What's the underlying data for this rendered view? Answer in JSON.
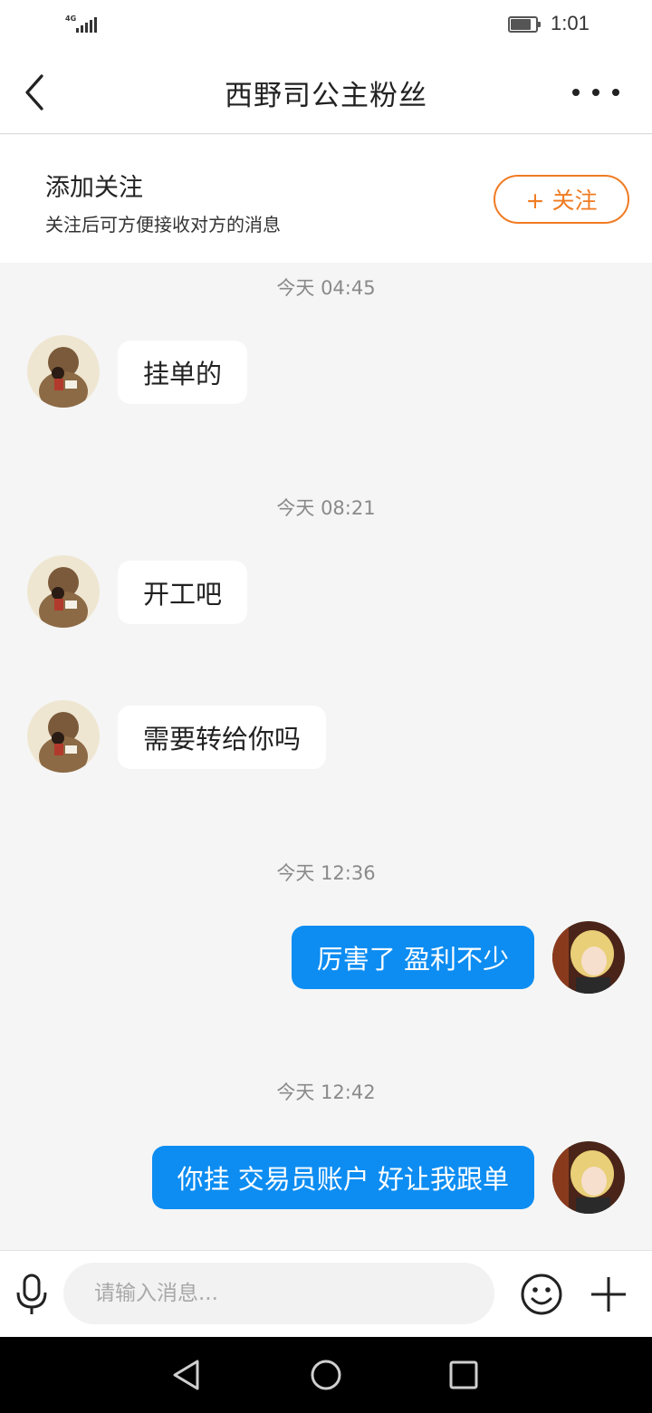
{
  "status_bar": {
    "network": "4G",
    "time": "1:01",
    "battery_level": 0.7
  },
  "header": {
    "title": "西野司公主粉丝",
    "back_icon": "chevron-left-icon",
    "more_icon": "more-horizontal-icon"
  },
  "follow_banner": {
    "title": "添加关注",
    "subtitle": "关注后可方便接收对方的消息",
    "button_label": "+ 关注",
    "accent_color": "#f07b22"
  },
  "chat": {
    "timestamps": [
      "今天 04:45",
      "今天 08:21",
      "今天 12:36",
      "今天 12:42"
    ],
    "messages": [
      {
        "text": "挂单的",
        "direction": "incoming"
      },
      {
        "text": "开工吧",
        "direction": "incoming"
      },
      {
        "text": "需要转给你吗",
        "direction": "incoming"
      },
      {
        "text": "厉害了 盈利不少",
        "direction": "outgoing"
      },
      {
        "text": "你挂 交易员账户 好让我跟单",
        "direction": "outgoing"
      }
    ],
    "outgoing_bubble_color": "#0d8df2",
    "incoming_bubble_color": "#ffffff"
  },
  "input_bar": {
    "placeholder": "请输入消息...",
    "mic_icon": "microphone-icon",
    "emoji_icon": "smiley-icon",
    "plus_icon": "plus-icon"
  },
  "nav_bar": {
    "back_icon": "triangle-back-icon",
    "home_icon": "circle-home-icon",
    "recents_icon": "square-recents-icon"
  }
}
